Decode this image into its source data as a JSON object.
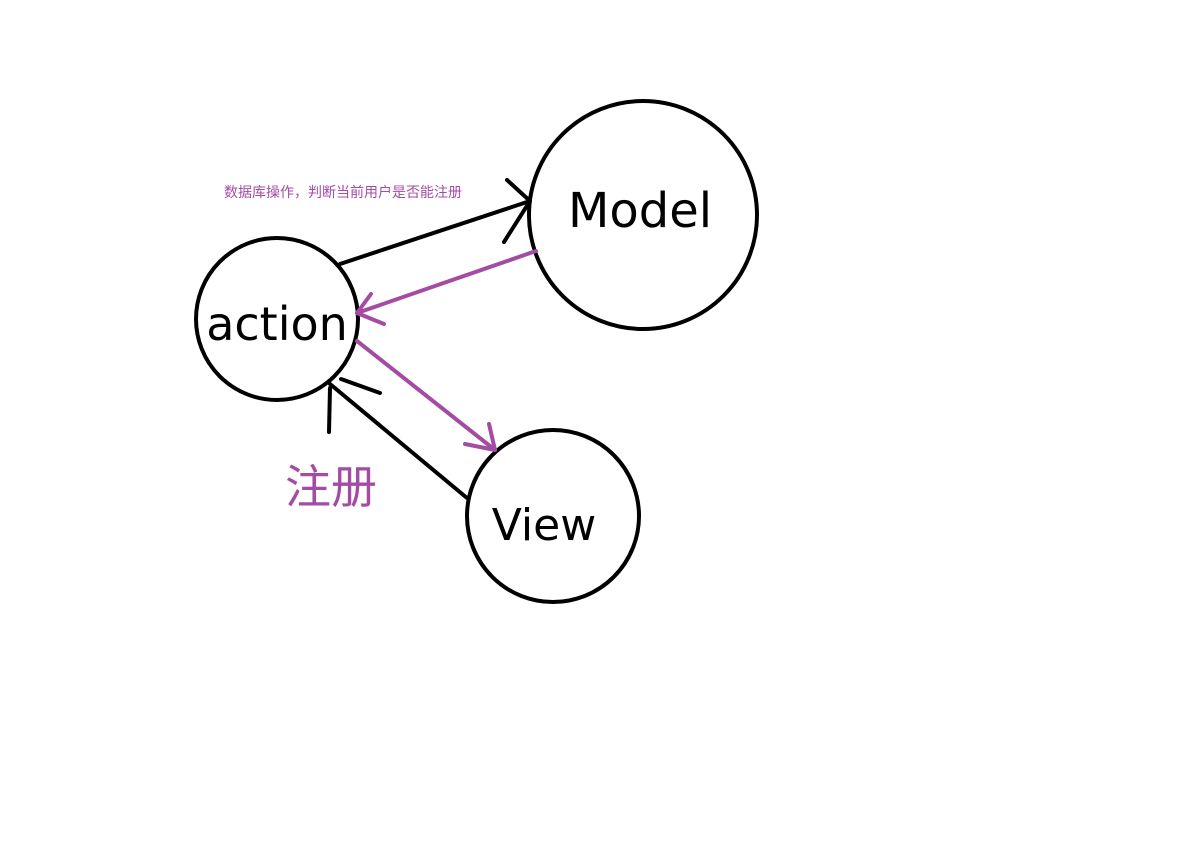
{
  "diagram": {
    "nodes": {
      "action": {
        "label": "action"
      },
      "model": {
        "label": "Model"
      },
      "view": {
        "label": "View"
      }
    },
    "annotations": {
      "db_note": "数据库操作，判断当前用户是否能注册",
      "register": "注册"
    },
    "colors": {
      "stroke_black": "#000000",
      "accent_purple": "#a44ca4",
      "background": "#ffffff"
    }
  }
}
